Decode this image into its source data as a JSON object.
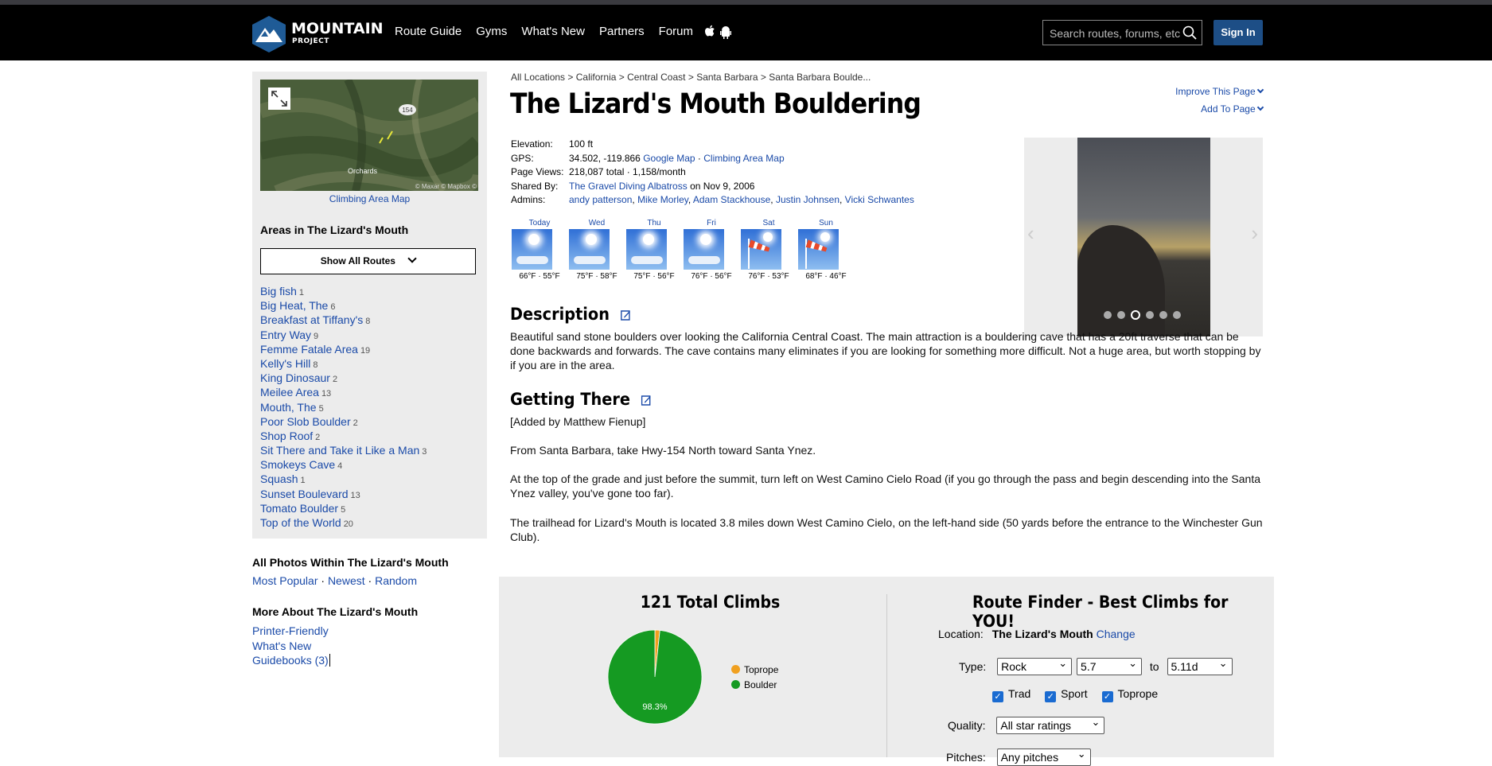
{
  "header": {
    "logo_title": "MOUNTAIN",
    "logo_sub": "PROJECT",
    "nav": [
      "Route Guide",
      "Gyms",
      "What's New",
      "Partners",
      "Forum"
    ],
    "search_placeholder": "Search routes, forums, etc",
    "signin": "Sign In"
  },
  "sidebar": {
    "map_label": "Climbing Area Map",
    "map_text_town": "Orchards",
    "map_text_road": "154",
    "map_credit": "© Maxar © Mapbox ©",
    "areas_title": "Areas in The Lizard's Mouth",
    "show_all": "Show All Routes",
    "areas": [
      {
        "name": "Big fish",
        "count": "1"
      },
      {
        "name": "Big Heat, The",
        "count": "6"
      },
      {
        "name": "Breakfast at Tiffany's",
        "count": "8"
      },
      {
        "name": "Entry Way",
        "count": "9"
      },
      {
        "name": "Femme Fatale Area",
        "count": "19"
      },
      {
        "name": "Kelly's Hill",
        "count": "8"
      },
      {
        "name": "King Dinosaur",
        "count": "2"
      },
      {
        "name": "Meilee Area",
        "count": "13"
      },
      {
        "name": "Mouth, The",
        "count": "5"
      },
      {
        "name": "Poor Slob Boulder",
        "count": "2"
      },
      {
        "name": "Shop Roof",
        "count": "2"
      },
      {
        "name": "Sit There and Take it Like a Man",
        "count": "3"
      },
      {
        "name": "Smokeys Cave",
        "count": "4"
      },
      {
        "name": "Squash",
        "count": "1"
      },
      {
        "name": "Sunset Boulevard",
        "count": "13"
      },
      {
        "name": "Tomato Boulder",
        "count": "5"
      },
      {
        "name": "Top of the World",
        "count": "20"
      }
    ],
    "photos_title": "All Photos Within The Lizard's Mouth",
    "photo_links": [
      "Most Popular",
      "Newest",
      "Random"
    ],
    "more_title": "More About The Lizard's Mouth",
    "more_links": [
      "Printer-Friendly",
      "What's New",
      "Guidebooks (3)"
    ]
  },
  "breadcrumb": [
    "All Locations",
    "California",
    "Central Coast",
    "Santa Barbara",
    "Santa Barbara Boulde..."
  ],
  "title": "The Lizard's Mouth Bouldering",
  "improve": "Improve This Page",
  "add_to": "Add To Page",
  "meta": {
    "elevation_k": "Elevation:",
    "elevation": "100 ft",
    "gps_k": "GPS:",
    "gps": "34.502, -119.866",
    "google_map": "Google Map",
    "climbing_map": "Climbing Area Map",
    "views_k": "Page Views:",
    "views": "218,087 total · 1,158/month",
    "shared_k": "Shared By:",
    "shared_by": "The Gravel Diving Albatross",
    "shared_date": "on Nov 9, 2006",
    "admins_k": "Admins:",
    "admins": [
      "andy patterson",
      "Mike Morley",
      "Adam Stackhouse",
      "Justin Johnsen",
      "Vicki Schwantes"
    ]
  },
  "weather": [
    {
      "day": "Today",
      "temp": "66°F · 55°F",
      "icon": "sunny"
    },
    {
      "day": "Wed",
      "temp": "75°F · 58°F",
      "icon": "sunny"
    },
    {
      "day": "Thu",
      "temp": "75°F · 56°F",
      "icon": "sunny"
    },
    {
      "day": "Fri",
      "temp": "76°F · 56°F",
      "icon": "sunny"
    },
    {
      "day": "Sat",
      "temp": "76°F · 53°F",
      "icon": "windy"
    },
    {
      "day": "Sun",
      "temp": "68°F · 46°F",
      "icon": "windy"
    }
  ],
  "description_title": "Description",
  "description": "Beautiful sand stone boulders over looking the California Central Coast. The main attraction is a bouldering cave that has a 20ft traverse that can be done backwards and forwards. The cave contains many eliminates if you are looking for something more difficult. Not a huge area, but worth stopping by if you are in the area.",
  "getting_title": "Getting There",
  "getting": [
    "[Added by Matthew Fienup]",
    "From Santa Barbara, take Hwy-154 North toward Santa Ynez.",
    "At the top of the grade and just before the summit, turn left on West Camino Cielo Road (if you go through the pass and begin descending into the Santa Ynez valley, you've gone too far).",
    "The trailhead for Lizard's Mouth is located 3.8 miles down West Camino Cielo, on the left-hand side (50 yards before the entrance to the Winchester Gun Club)."
  ],
  "climbs": {
    "title": "121 Total Climbs",
    "pie_label": "98.3%"
  },
  "chart_data": {
    "type": "pie",
    "labels": [
      "Toprope",
      "Boulder"
    ],
    "values": [
      1.7,
      98.3
    ],
    "colors": [
      "#f0a020",
      "#159a22"
    ],
    "legend": "right"
  },
  "route_finder": {
    "title": "Route Finder - Best Climbs for YOU!",
    "location_k": "Location:",
    "location": "The Lizard's Mouth",
    "change": "Change",
    "type_k": "Type:",
    "type": "Rock",
    "from": "5.7",
    "to_word": "to",
    "to": "5.11d",
    "checks": [
      "Trad",
      "Sport",
      "Toprope"
    ],
    "quality_k": "Quality:",
    "quality": "All star ratings",
    "pitches_k": "Pitches:",
    "pitches": "Any pitches"
  },
  "colors": {
    "link": "#1a4aa8",
    "signin": "#1d4e86",
    "nav_bg": "#000000"
  }
}
